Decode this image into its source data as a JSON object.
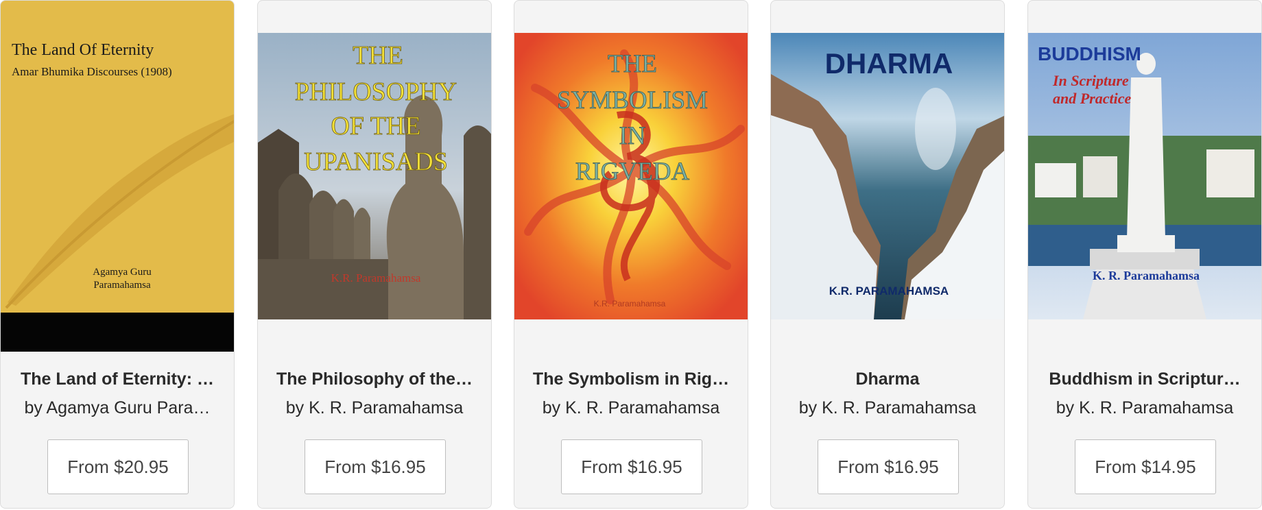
{
  "books": [
    {
      "cover_text": {
        "title": "The Land Of Eternity",
        "subtitle": "Amar Bhumika Discourses (1908)",
        "author_line1": "Agamya Guru",
        "author_line2": "Paramahamsa"
      },
      "title": "The Land of Eternity: …",
      "author": "by Agamya Guru Para…",
      "price": "From $20.95"
    },
    {
      "cover_text": {
        "line1": "THE",
        "line2": "PHILOSOPHY",
        "line3": "OF THE",
        "line4": "UPANISADS",
        "author": "K.R. Paramahamsa"
      },
      "title": "The Philosophy of the…",
      "author": "by K. R. Paramahamsa",
      "price": "From $16.95"
    },
    {
      "cover_text": {
        "line1": "THE",
        "line2": "SYMBOLISM",
        "line3": "IN",
        "line4": "RIGVEDA",
        "author": "K.R. Paramahamsa"
      },
      "title": "The Symbolism in Rig…",
      "author": "by K. R. Paramahamsa",
      "price": "From $16.95"
    },
    {
      "cover_text": {
        "title": "DHARMA",
        "author": "K.R. PARAMAHAMSA"
      },
      "title": "Dharma",
      "author": "by K. R. Paramahamsa",
      "price": "From $16.95"
    },
    {
      "cover_text": {
        "title": "BUDDHISM",
        "subtitle1": "In Scripture",
        "subtitle2": "and Practice",
        "author": "K. R. Paramahamsa"
      },
      "title": "Buddhism in Scriptur…",
      "author": "by K. R. Paramahamsa",
      "price": "From $14.95"
    }
  ]
}
